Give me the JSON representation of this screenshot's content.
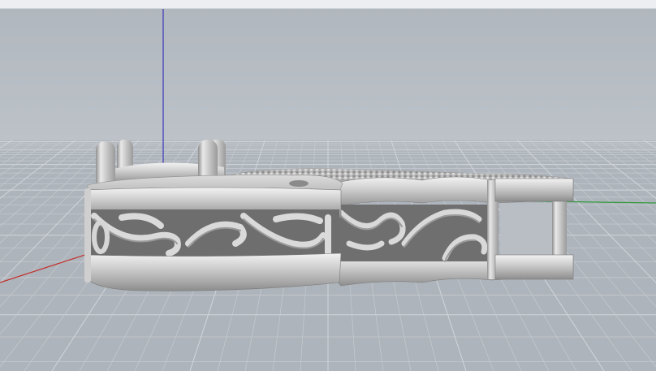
{
  "viewport": {
    "projection": "perspective",
    "background_sky": "#b6bcc3",
    "background_floor": "#aeb4bb",
    "grid_minor_color": "#c6cbd1",
    "grid_major_color": "#d2d6db"
  },
  "axes": {
    "x_color": "#c0302a",
    "y_color": "#2f9a3a",
    "z_color": "#3a36b8"
  },
  "model": {
    "material_color": "#c9c9c9",
    "shading": "rendered",
    "parts": [
      "pendant-bail-with-prongs",
      "filigree-band",
      "pave-section",
      "open-frame-end"
    ]
  }
}
